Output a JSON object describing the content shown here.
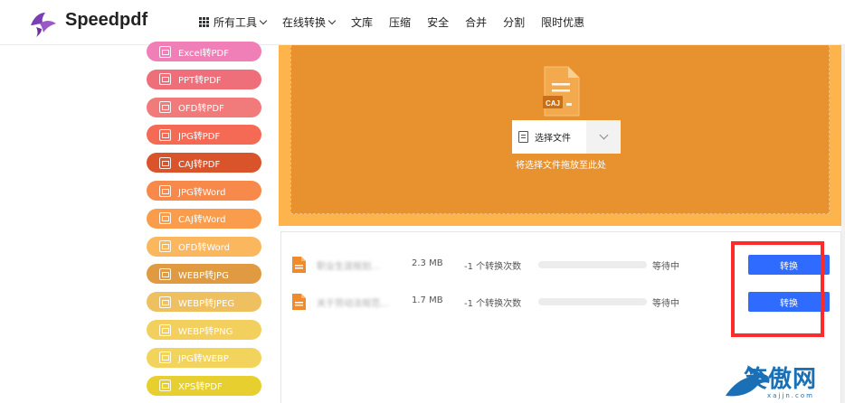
{
  "header": {
    "brand": "Speedpdf",
    "nav": [
      {
        "label": "所有工具",
        "has_grid_icon": true,
        "has_dropdown": true
      },
      {
        "label": "在线转换",
        "has_dropdown": true
      },
      {
        "label": "文库"
      },
      {
        "label": "压缩"
      },
      {
        "label": "安全"
      },
      {
        "label": "合并"
      },
      {
        "label": "分割"
      },
      {
        "label": "限时优惠"
      }
    ]
  },
  "sidebar": {
    "items": [
      {
        "label": "Excel转PDF",
        "color": "#f07fb8"
      },
      {
        "label": "PPT转PDF",
        "color": "#ee6f7a"
      },
      {
        "label": "OFD转PDF",
        "color": "#f17a7a"
      },
      {
        "label": "JPG转PDF",
        "color": "#f56a55"
      },
      {
        "label": "CAJ转PDF",
        "color": "#d9542b"
      },
      {
        "label": "JPG转Word",
        "color": "#f7894a"
      },
      {
        "label": "CAJ转Word",
        "color": "#f99d4c"
      },
      {
        "label": "OFD转Word",
        "color": "#fbb75e"
      },
      {
        "label": "WEBP转JPG",
        "color": "#df9a42"
      },
      {
        "label": "WEBP转JPEG",
        "color": "#efc060"
      },
      {
        "label": "WEBP转PNG",
        "color": "#f3cf5e"
      },
      {
        "label": "JPG转WEBP",
        "color": "#f2d35b"
      },
      {
        "label": "XPS转PDF",
        "color": "#e6cf2f"
      }
    ]
  },
  "upload": {
    "file_icon_label": "CAJ",
    "select_button": "选择文件",
    "drag_hint": "将选择文件拖放至此处"
  },
  "files": [
    {
      "name": "​职业生涯规划…",
      "size": "2.3 MB",
      "count": "-1 个转换次数",
      "progress": 0,
      "status": "等待中",
      "button": "转换"
    },
    {
      "name": "关于劳动法规范…",
      "size": "1.7 MB",
      "count": "-1 个转换次数",
      "progress": 0,
      "status": "等待中",
      "button": "转换"
    }
  ],
  "watermark": {
    "text": "笑傲网",
    "url": "xajjn.com"
  },
  "colors": {
    "accent": "#2f6bff",
    "upload_bg": "#e8922f",
    "highlight": "#ff2b2b"
  }
}
